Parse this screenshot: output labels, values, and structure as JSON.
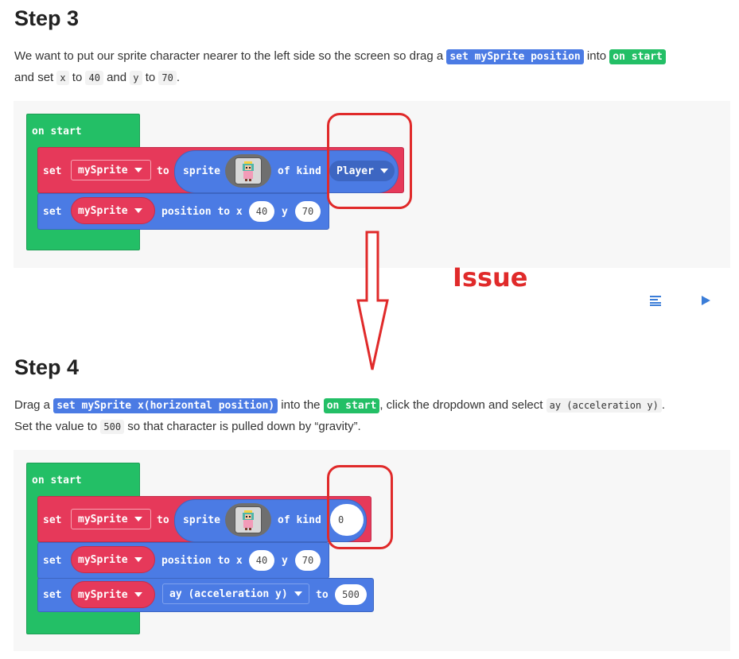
{
  "step3": {
    "heading": "Step 3",
    "line1_a": "We want to put our sprite character nearer to the left side so the screen so drag a ",
    "chip_block": "set mySprite position",
    "line1_b": " into ",
    "chip_onstart": "on start",
    "line2_a": "and set ",
    "code_x": "x",
    "line2_b": " to ",
    "code_40": "40",
    "line2_c": " and ",
    "code_y": "y",
    "line2_d": " to ",
    "code_70": "70",
    "line2_e": "."
  },
  "step4": {
    "heading": "Step 4",
    "line1_a": "Drag a ",
    "chip_block": "set mySprite x(horizontal position)",
    "line1_b": " into the ",
    "chip_onstart": "on start",
    "line1_c": ", click the dropdown and select ",
    "code_ay": "ay (acceleration y)",
    "line1_d": ".",
    "line2_a": "Set the value to ",
    "code_500": "500",
    "line2_b": " so that character is pulled down by “gravity”."
  },
  "blocks": {
    "on_start": "on start",
    "set": "set",
    "var": "mySprite",
    "to": "to",
    "sprite": "sprite",
    "of_kind": "of kind",
    "kind_player": "Player",
    "kind_zero": "0",
    "position_to_x": "position to x",
    "y": "y",
    "x_val": "40",
    "y_val": "70",
    "prop": "ay (acceleration y)",
    "prop_val": "500"
  },
  "annotation": {
    "label": "Issue",
    "color": "#e02a2a"
  },
  "colors": {
    "green_block": "#23bf66",
    "red_block": "#e6395a",
    "blue_block": "#4b7be4"
  },
  "icons": {
    "format": "align-left-icon",
    "run": "play-icon"
  }
}
